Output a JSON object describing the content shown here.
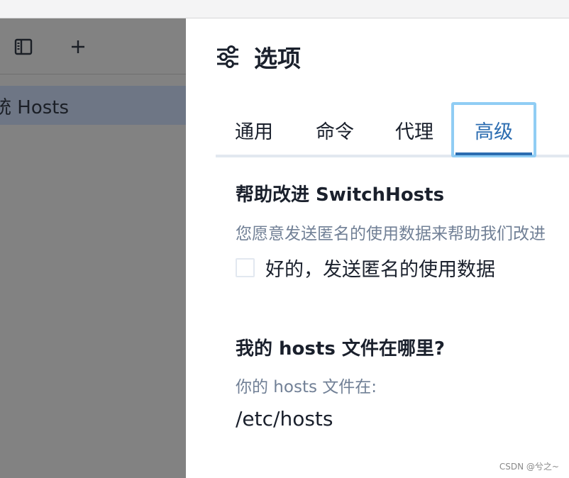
{
  "sidebar": {
    "toolbar": {
      "toggle_icon": "sidebar-toggle-icon",
      "add_icon": "plus-icon",
      "add_label": "+"
    },
    "items": [
      {
        "label": "统 Hosts"
      }
    ]
  },
  "panel": {
    "icon": "sliders-icon",
    "title": "选项",
    "tabs": [
      {
        "label": "通用"
      },
      {
        "label": "命令"
      },
      {
        "label": "代理"
      },
      {
        "label": "高级",
        "active": true
      }
    ],
    "improve": {
      "title": "帮助改进 SwitchHosts",
      "description": "您愿意发送匿名的使用数据来帮助我们改进",
      "checkbox_label": "好的，发送匿名的使用数据",
      "checked": false
    },
    "hosts_location": {
      "title": "我的 hosts 文件在哪里?",
      "description": "你的 hosts 文件在:",
      "path": "/etc/hosts"
    }
  },
  "watermark": "CSDN @兮之~",
  "colors": {
    "accent": "#2b6cb0",
    "focus_ring": "#90cdf4",
    "sidebar_bg": "#828282",
    "sidebar_selected": "#6e7685",
    "muted_text": "#718096"
  }
}
